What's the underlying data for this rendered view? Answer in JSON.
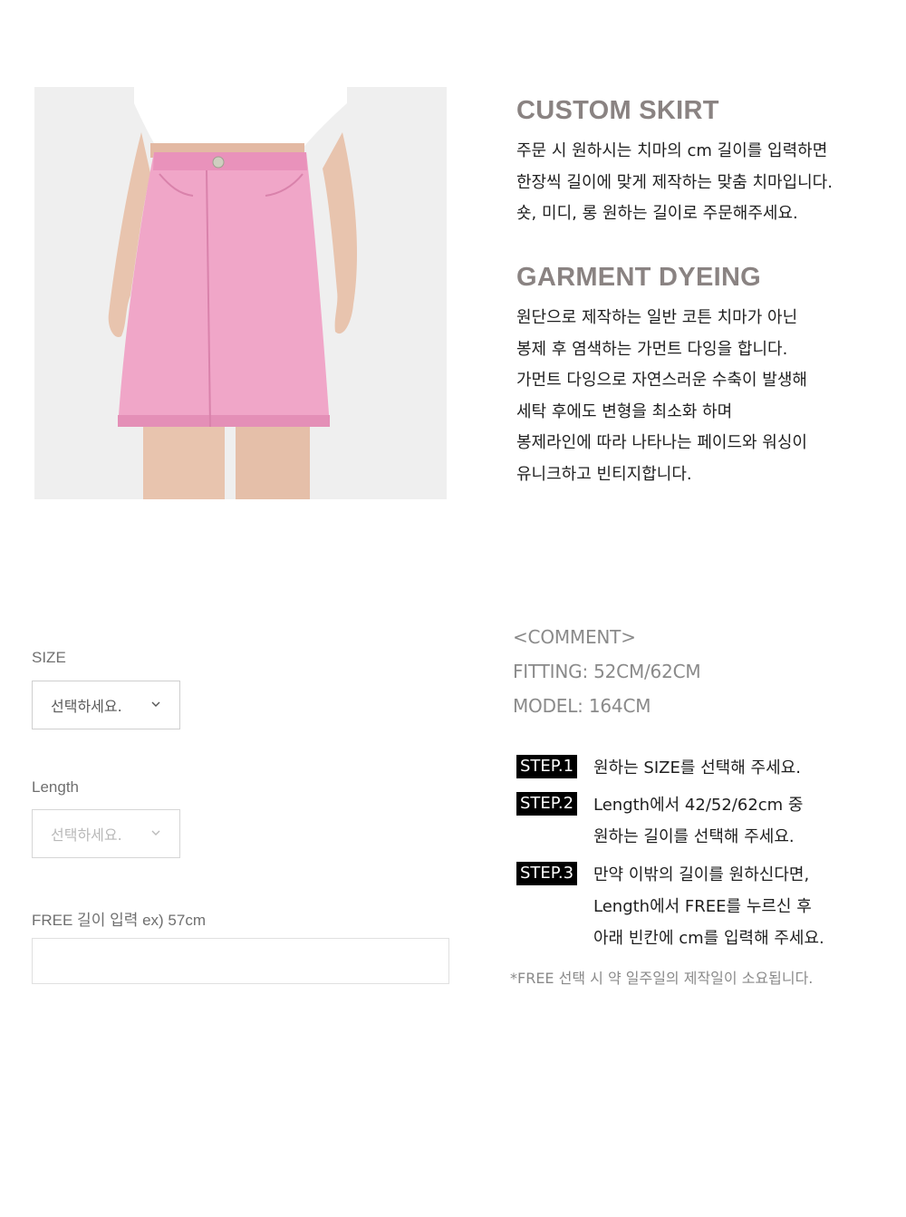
{
  "product_image": {
    "alt": "pink denim a-line skirt"
  },
  "custom": {
    "title": "CUSTOM SKIRT",
    "lines": [
      "주문 시 원하시는 치마의 cm 길이를 입력하면",
      "한장씩 길이에 맞게 제작하는 맞춤 치마입니다.",
      "숏, 미디, 롱 원하는 길이로 주문해주세요."
    ]
  },
  "garment": {
    "title": "GARMENT DYEING",
    "lines": [
      "원단으로 제작하는 일반 코튼 치마가 아닌",
      "봉제 후 염색하는 가먼트 다잉을 합니다.",
      "가먼트 다잉으로 자연스러운 수축이 발생해",
      "세탁 후에도 변형을 최소화 하며",
      "봉제라인에 따라 나타나는 페이드와 워싱이",
      "유니크하고 빈티지합니다."
    ]
  },
  "options": {
    "size_label": "SIZE",
    "size_value": "선택하세요.",
    "length_label": "Length",
    "length_value": "선택하세요.",
    "free_label": "FREE 길이 입력 ex) 57cm",
    "free_value": ""
  },
  "comment": {
    "header": "<COMMENT>",
    "fitting": "FITTING: 52CM/62CM",
    "model": "MODEL: 164CM"
  },
  "steps": [
    {
      "badge": "STEP.1",
      "lines": [
        "원하는 SIZE를 선택해 주세요."
      ]
    },
    {
      "badge": "STEP.2",
      "lines": [
        "Length에서 42/52/62cm 중",
        "원하는 길이를 선택해 주세요."
      ]
    },
    {
      "badge": "STEP.3",
      "lines": [
        "만약 이밖의 길이를 원하신다면,",
        "Length에서 FREE를 누르신 후",
        "아래 빈칸에 cm를 입력해 주세요."
      ]
    }
  ],
  "note": "*FREE 선택 시 약 일주일의 제작일이 소요됩니다.",
  "colors": {
    "title_gray": "#8a8382",
    "skirt_pink": "#f0a6c8",
    "badge_bg": "#000000"
  },
  "icons": {
    "select_arrow": "chevron-down-icon"
  }
}
